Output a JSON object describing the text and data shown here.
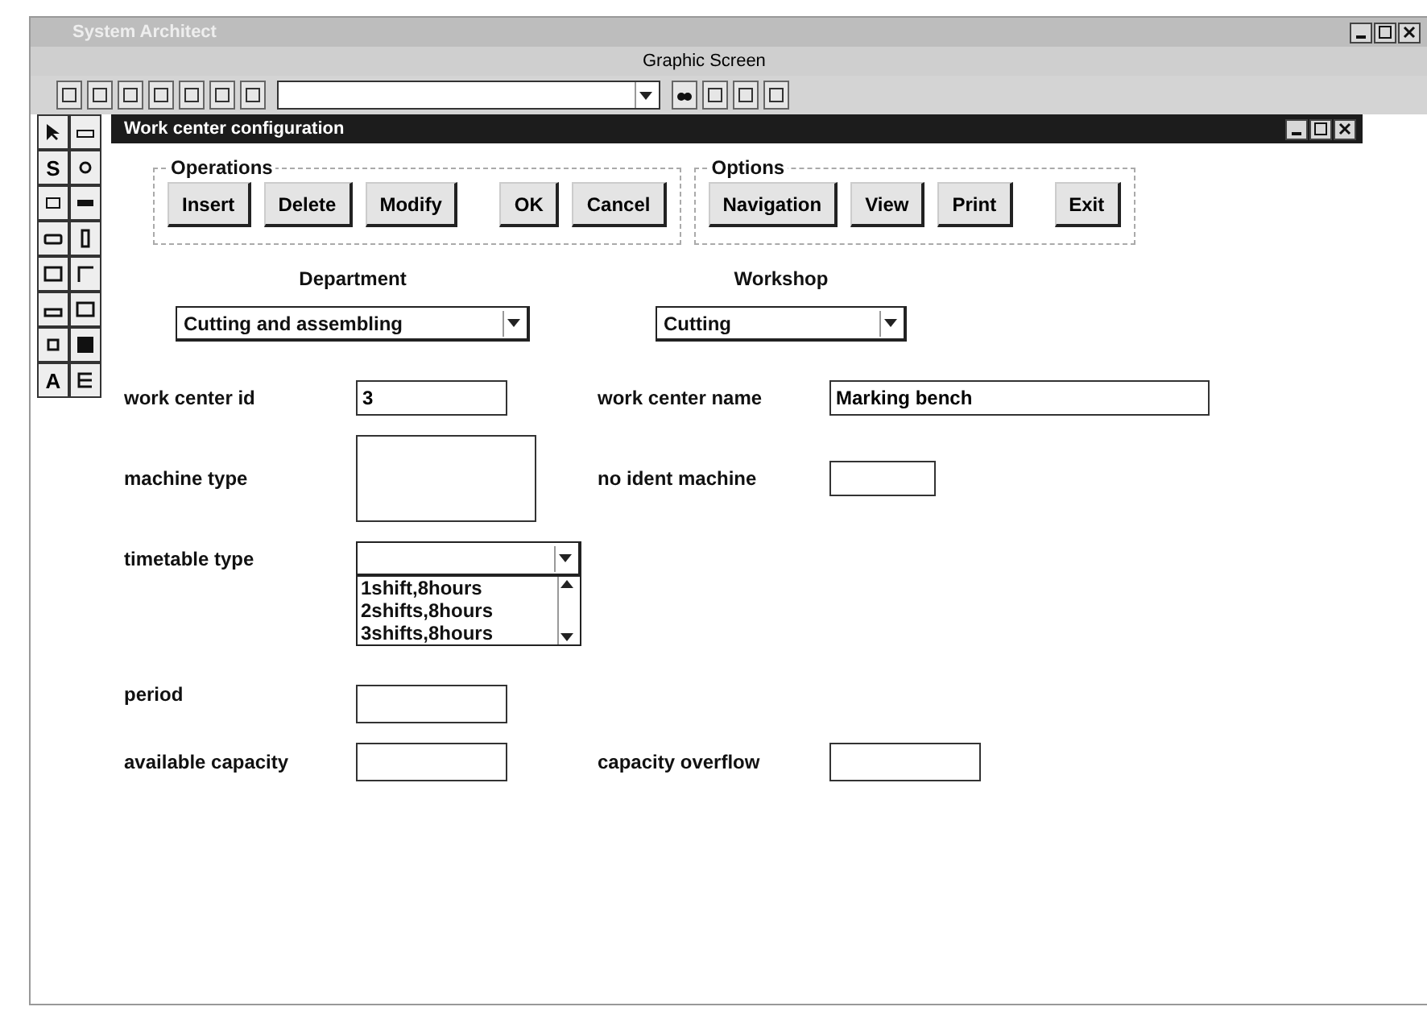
{
  "app_window": {
    "title": "System Architect",
    "menu": [
      {
        "label": "Graphic Screen"
      }
    ]
  },
  "tools": [
    {
      "kind": "arrow"
    },
    {
      "kind": "bar"
    },
    {
      "kind": "glyph",
      "glyph": "S"
    },
    {
      "kind": "dot"
    },
    {
      "kind": "circle"
    },
    {
      "kind": "pair"
    },
    {
      "kind": "pill"
    },
    {
      "kind": "tall"
    },
    {
      "kind": "rect"
    },
    {
      "kind": "corner"
    },
    {
      "kind": "strip"
    },
    {
      "kind": "rect"
    },
    {
      "kind": "square"
    },
    {
      "kind": "solid"
    },
    {
      "kind": "glyph",
      "glyph": "A"
    },
    {
      "kind": "bracket"
    }
  ],
  "dialog": {
    "title": "Work center configuration",
    "groups": [
      {
        "title": "Operations",
        "buttons": [
          {
            "label": "Insert"
          },
          {
            "label": "Delete"
          },
          {
            "label": "Modify"
          },
          {
            "label": "OK"
          },
          {
            "label": "Cancel"
          }
        ]
      },
      {
        "title": "Options",
        "buttons": [
          {
            "label": "Navigation"
          },
          {
            "label": "View"
          },
          {
            "label": "Print"
          },
          {
            "label": "Exit"
          }
        ]
      }
    ],
    "selectors": [
      {
        "label": "Department",
        "value": "Cutting and assembling"
      },
      {
        "label": "Workshop",
        "value": "Cutting"
      }
    ],
    "fields": {
      "work_center_id": {
        "label": "work center id",
        "value": "3"
      },
      "work_center_name": {
        "label": "work center name",
        "value": "Marking bench"
      },
      "machine_type": {
        "label": "machine type"
      },
      "no_ident_machine": {
        "label": "no ident machine"
      },
      "timetable_type": {
        "label": "timetable type",
        "options": [
          "1shift,8hours",
          "2shifts,8hours",
          "3shifts,8hours"
        ]
      },
      "period": {
        "label": "period"
      },
      "available_capacity": {
        "label": "available capacity"
      },
      "capacity_overflow": {
        "label": "capacity overflow"
      }
    }
  }
}
